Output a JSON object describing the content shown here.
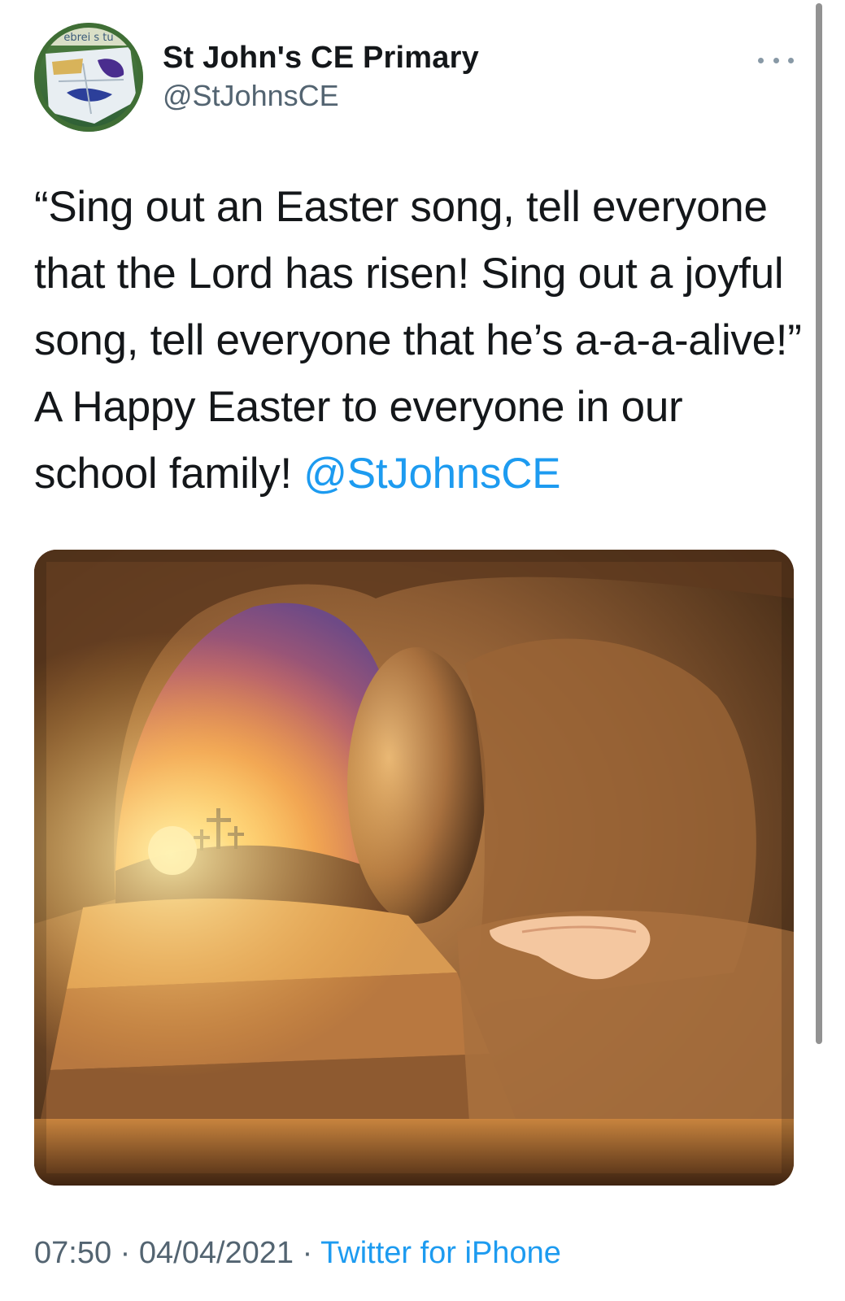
{
  "profile": {
    "display_name": "St John's CE Primary",
    "handle": "@StJohnsCE",
    "avatar_text": "ebrei s tu",
    "more_icon": "more-horizontal-icon"
  },
  "tweet": {
    "text": "“Sing out an Easter song, tell everyone that the Lord has risen! Sing out a joyful song, tell everyone that he’s a-a-a-alive!” A Happy Easter to everyone in our school family! ",
    "mention": "@StJohnsCE",
    "image_alt": "Empty tomb opening onto a sunrise with three crosses on a hill"
  },
  "meta": {
    "time": "07:50",
    "sep1": " · ",
    "date": "04/04/2021",
    "sep2": " · ",
    "source": "Twitter for iPhone"
  },
  "colors": {
    "link": "#1d9bf0",
    "secondary_text": "#536471",
    "primary_text": "#14171a"
  }
}
